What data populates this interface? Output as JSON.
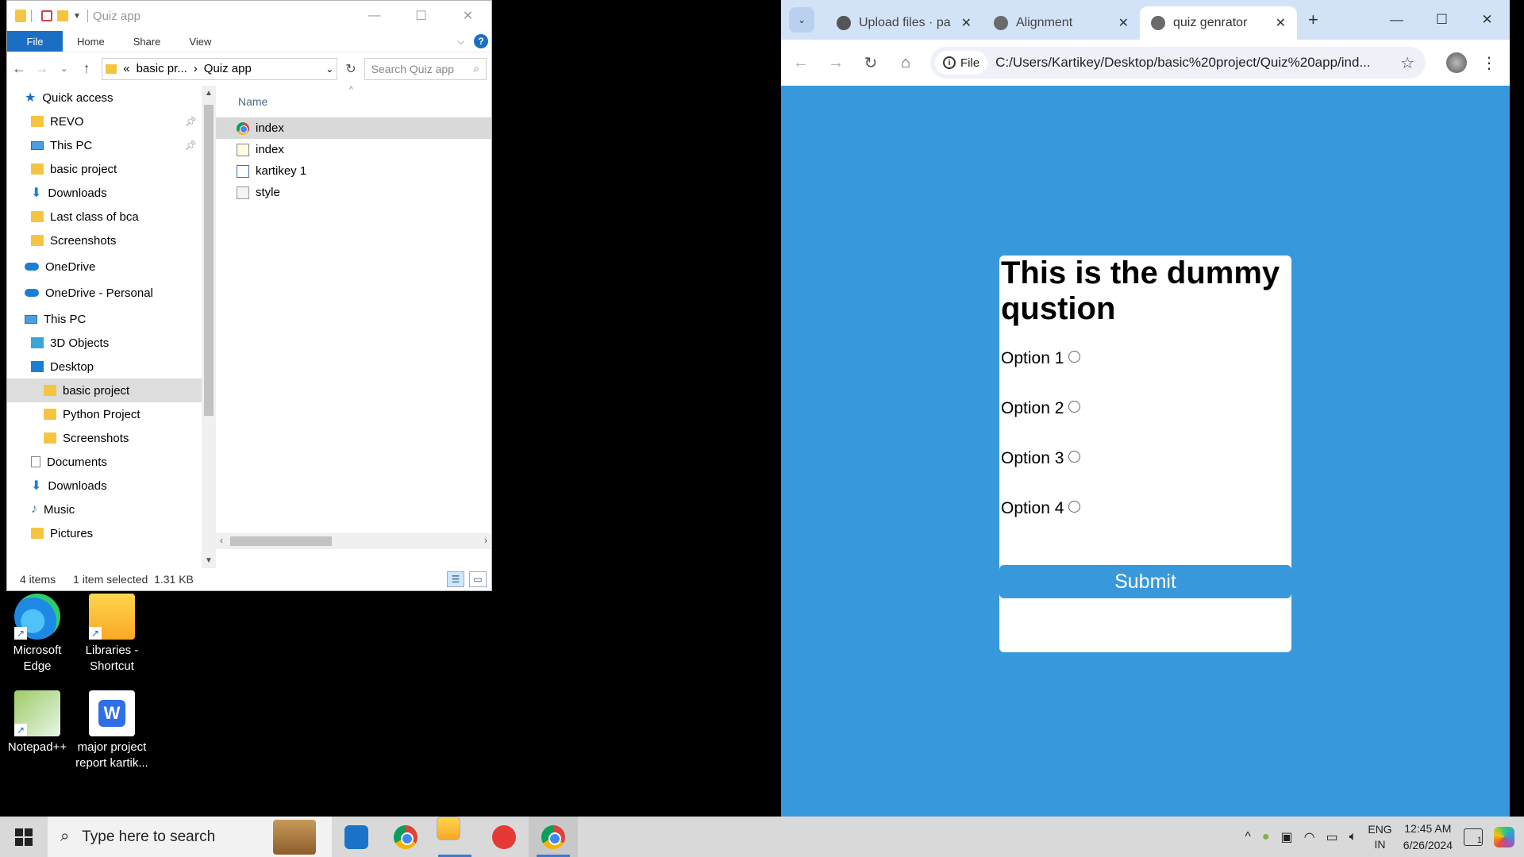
{
  "explorer": {
    "title": "Quiz app",
    "ribbon_tabs": [
      "File",
      "Home",
      "Share",
      "View"
    ],
    "address": {
      "prefix": "«",
      "crumb1": "basic pr...",
      "crumb2": "Quiz app"
    },
    "search_placeholder": "Search Quiz app",
    "nav_items": [
      {
        "label": "Quick access",
        "icon": "star-icon",
        "level": 0,
        "pinned": false
      },
      {
        "label": "REVO",
        "icon": "folder-icon",
        "level": 1,
        "pinned": true
      },
      {
        "label": "This PC",
        "icon": "computer-icon",
        "level": 1,
        "pinned": true
      },
      {
        "label": "basic project",
        "icon": "folder-icon",
        "level": 1,
        "pinned": false
      },
      {
        "label": "Downloads",
        "icon": "download-icon",
        "level": 1,
        "pinned": false
      },
      {
        "label": "Last class of bca",
        "icon": "folder-icon",
        "level": 1,
        "pinned": false
      },
      {
        "label": "Screenshots",
        "icon": "folder-icon",
        "level": 1,
        "pinned": false
      },
      {
        "label": "OneDrive",
        "icon": "cloud-icon",
        "level": 0,
        "pinned": false
      },
      {
        "label": "OneDrive - Personal",
        "icon": "cloud-icon",
        "level": 0,
        "pinned": false
      },
      {
        "label": "This PC",
        "icon": "computer-icon",
        "level": 0,
        "pinned": false
      },
      {
        "label": "3D Objects",
        "icon": "cube-icon",
        "level": 1,
        "pinned": false
      },
      {
        "label": "Desktop",
        "icon": "desktop-icon",
        "level": 1,
        "pinned": false
      },
      {
        "label": "basic project",
        "icon": "folder-icon",
        "level": 2,
        "pinned": false,
        "selected": true
      },
      {
        "label": "Python Project",
        "icon": "folder-icon",
        "level": 2,
        "pinned": false
      },
      {
        "label": "Screenshots",
        "icon": "folder-icon",
        "level": 2,
        "pinned": false
      },
      {
        "label": "Documents",
        "icon": "document-icon",
        "level": 1,
        "pinned": false
      },
      {
        "label": "Downloads",
        "icon": "download-icon",
        "level": 1,
        "pinned": false
      },
      {
        "label": "Music",
        "icon": "music-icon",
        "level": 1,
        "pinned": false
      },
      {
        "label": "Pictures",
        "icon": "folder-icon",
        "level": 1,
        "pinned": false
      }
    ],
    "column_header": "Name",
    "files": [
      {
        "name": "index",
        "icon": "chrome-file-icon",
        "selected": true
      },
      {
        "name": "index",
        "icon": "js-file-icon",
        "selected": false
      },
      {
        "name": "kartikey 1",
        "icon": "pdf-file-icon",
        "selected": false
      },
      {
        "name": "style",
        "icon": "css-file-icon",
        "selected": false
      }
    ],
    "status": {
      "count": "4 items",
      "selection": "1 item selected",
      "size": "1.31 KB"
    }
  },
  "desktop_icons": [
    {
      "label1": "Microsoft",
      "label2": "Edge",
      "icon": "edge-icon"
    },
    {
      "label1": "Libraries -",
      "label2": "Shortcut",
      "icon": "libraries-icon"
    },
    {
      "label1": "Notepad++",
      "label2": "",
      "icon": "notepadpp-icon"
    },
    {
      "label1": "major project",
      "label2": "report kartik...",
      "icon": "wps-doc-icon"
    }
  ],
  "browser": {
    "tabs": [
      {
        "title": "Upload files · pa",
        "icon": "github-icon",
        "active": false
      },
      {
        "title": "Alignment",
        "icon": "globe-icon",
        "active": false
      },
      {
        "title": "quiz genrator",
        "icon": "globe-icon",
        "active": true
      }
    ],
    "file_chip": "File",
    "url": "C:/Users/Kartikey/Desktop/basic%20project/Quiz%20app/ind...",
    "page_bg": "#3898dc"
  },
  "quiz": {
    "question": "This is the dummy qustion",
    "options": [
      "Option 1",
      "Option 2",
      "Option 3",
      "Option 4"
    ],
    "submit": "Submit"
  },
  "taskbar": {
    "search_placeholder": "Type here to search",
    "lang1": "ENG",
    "lang2": "IN",
    "time": "12:45 AM",
    "date": "6/26/2024",
    "notifications": "1"
  }
}
